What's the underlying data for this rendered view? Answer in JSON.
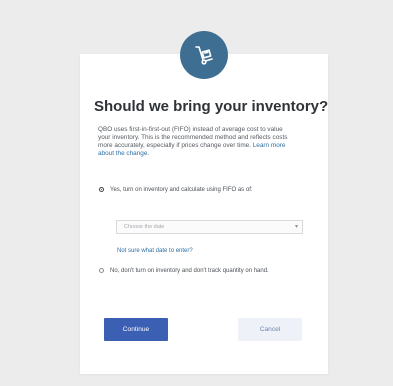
{
  "dialog": {
    "icon": "inventory-dolly-icon",
    "title": "Should we bring your inventory?",
    "description": "QBO uses first-in-first-out (FIFO) instead of average cost to value your inventory. This is the recommended method and reflects costs more accurately, especially if prices change over time.",
    "learn_more": "Learn more about the change.",
    "option_1": {
      "label": "Yes, turn on inventory and calculate using FIFO as of:",
      "selected": true
    },
    "date_select": {
      "placeholder": "Choose the date"
    },
    "help_link": "Not sure what date to enter?",
    "option_2": {
      "label": "No, don't turn on inventory and don't track quantity on hand.",
      "selected": false
    },
    "continue_label": "Continue",
    "cancel_label": "Cancel"
  },
  "colors": {
    "page_background": "#ececec",
    "icon_circle": "#3e6f93",
    "primary_button": "#3b5fb3",
    "secondary_button": "#eef2f8",
    "link": "#2f6ea5"
  }
}
